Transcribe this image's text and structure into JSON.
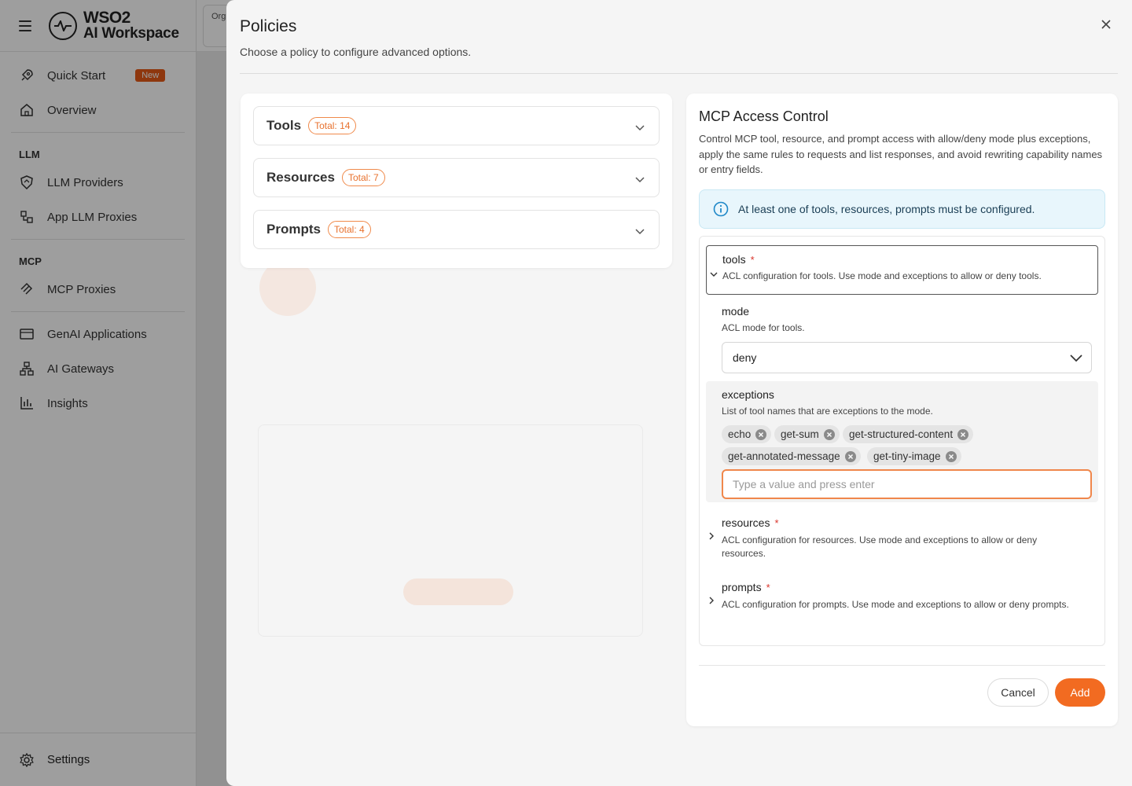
{
  "app": {
    "logo_line1": "WSO2",
    "logo_line2": "AI Workspace",
    "org_label": "Org"
  },
  "sidebar": {
    "items": [
      {
        "label": "Quick Start",
        "icon": "rocket-icon",
        "badge": "New"
      },
      {
        "label": "Overview",
        "icon": "home-icon"
      }
    ],
    "llm_section": "LLM",
    "llm_items": [
      {
        "label": "LLM Providers",
        "icon": "shield-icon"
      },
      {
        "label": "App LLM Proxies",
        "icon": "proxy-icon"
      }
    ],
    "mcp_section": "MCP",
    "mcp_items": [
      {
        "label": "MCP Proxies",
        "icon": "mcp-icon"
      }
    ],
    "other_items": [
      {
        "label": "GenAI Applications",
        "icon": "app-window-icon"
      },
      {
        "label": "AI Gateways",
        "icon": "hierarchy-icon"
      },
      {
        "label": "Insights",
        "icon": "bar-chart-icon"
      }
    ],
    "settings_label": "Settings"
  },
  "modal": {
    "title": "Policies",
    "subtitle": "Choose a policy to configure advanced options.",
    "accordions": [
      {
        "label": "Tools",
        "badge": "Total: 14"
      },
      {
        "label": "Resources",
        "badge": "Total: 7"
      },
      {
        "label": "Prompts",
        "badge": "Total: 4"
      }
    ],
    "policy": {
      "title": "MCP Access Control",
      "description": "Control MCP tool, resource, and prompt access with allow/deny mode plus exceptions, apply the same rules to requests and list responses, and avoid rewriting capability names or entry fields.",
      "info": "At least one of tools, resources, prompts must be configured.",
      "tools": {
        "name": "tools",
        "required": "*",
        "description": "ACL configuration for tools. Use mode and exceptions to allow or deny tools.",
        "mode_label": "mode",
        "mode_desc": "ACL mode for tools.",
        "mode_value": "deny",
        "exceptions_label": "exceptions",
        "exceptions_desc": "List of tool names that are exceptions to the mode.",
        "exceptions": [
          "echo",
          "get-sum",
          "get-structured-content",
          "get-annotated-message",
          "get-tiny-image"
        ],
        "input_placeholder": "Type a value and press enter"
      },
      "resources": {
        "name": "resources",
        "required": "*",
        "description": "ACL configuration for resources. Use mode and exceptions to allow or deny resources."
      },
      "prompts": {
        "name": "prompts",
        "required": "*",
        "description": "ACL configuration for prompts. Use mode and exceptions to allow or deny prompts."
      },
      "cancel_label": "Cancel",
      "add_label": "Add"
    }
  },
  "colors": {
    "accent": "#f26b21",
    "badge_border": "#f08a4b",
    "info_bg": "#e8f6fc",
    "required": "#d9342b"
  }
}
